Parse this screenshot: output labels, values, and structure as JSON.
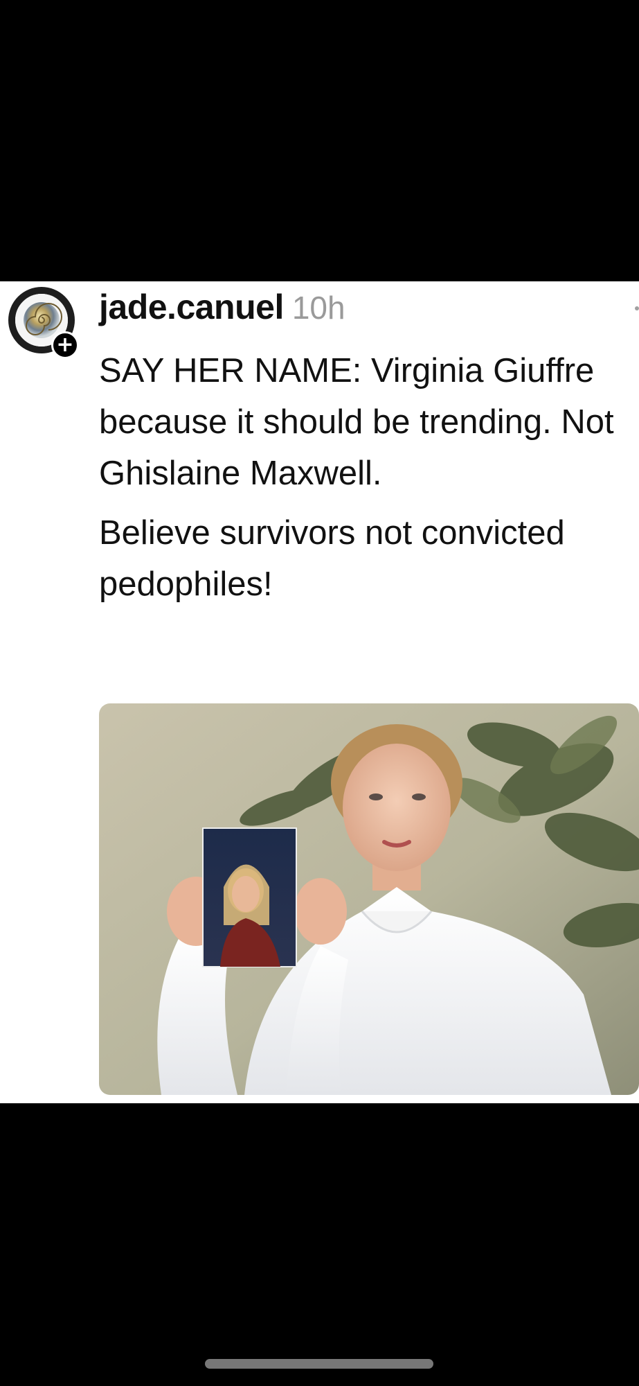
{
  "post": {
    "username": "jade.canuel",
    "timestamp": "10h",
    "paragraphs": [
      "SAY HER NAME: Virginia Giuffre because it should be trending. Not Ghislaine Maxwell.",
      "Believe survivors not convicted pedophiles!"
    ],
    "follow_badge": "+",
    "image_alt": "photo of a woman in a white blouse holding an old photograph"
  },
  "icons": {
    "avatar": "ammonite-shell-avatar",
    "follow": "plus-icon",
    "more": "more-options-icon"
  },
  "colors": {
    "background": "#000000",
    "card": "#ffffff",
    "text": "#111111",
    "timestamp": "#9a9a9a"
  }
}
